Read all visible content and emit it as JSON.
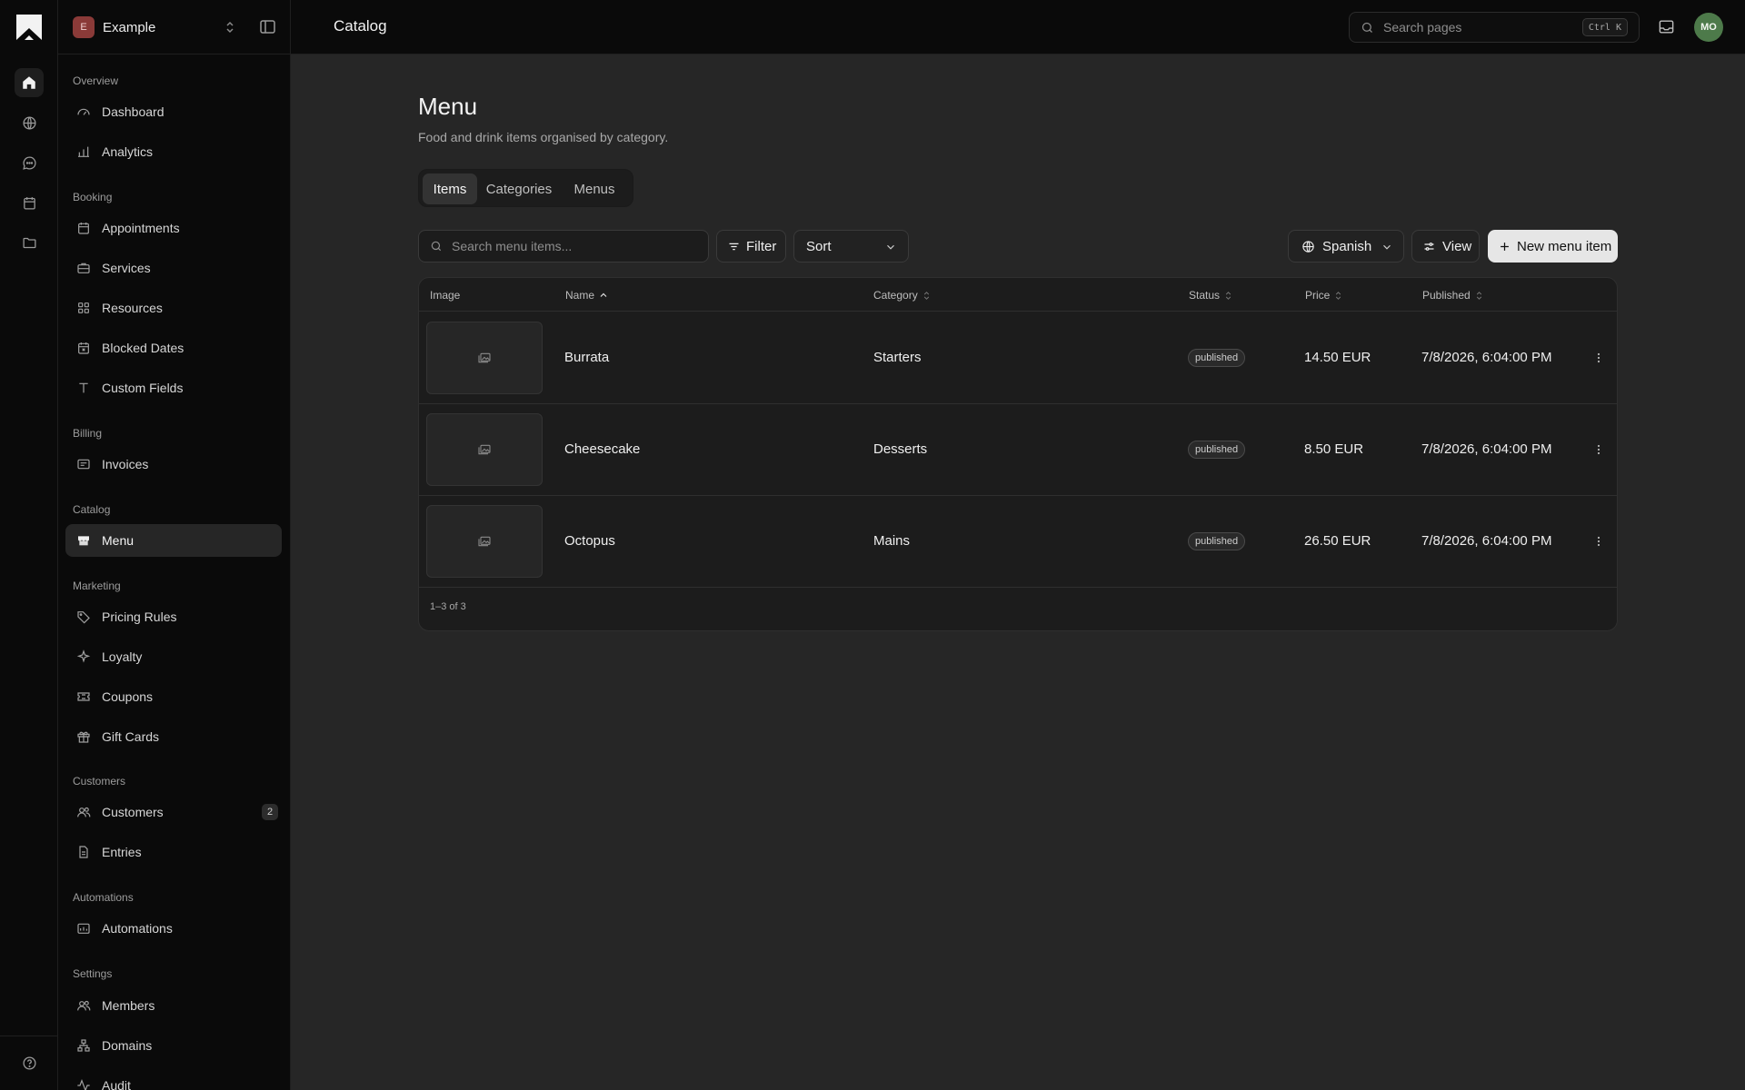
{
  "workspace": {
    "initial": "E",
    "name": "Example"
  },
  "header": {
    "title": "Catalog",
    "search_placeholder": "Search pages",
    "shortcut": "Ctrl K",
    "avatar_initials": "MO"
  },
  "sidebar": {
    "groups": {
      "overview": "Overview",
      "booking": "Booking",
      "billing": "Billing",
      "catalog": "Catalog",
      "marketing": "Marketing",
      "customers": "Customers",
      "automations": "Automations",
      "settings": "Settings"
    },
    "items": {
      "dashboard": "Dashboard",
      "analytics": "Analytics",
      "appointments": "Appointments",
      "services": "Services",
      "resources": "Resources",
      "blocked_dates": "Blocked Dates",
      "custom_fields": "Custom Fields",
      "invoices": "Invoices",
      "menu": "Menu",
      "pricing_rules": "Pricing Rules",
      "loyalty": "Loyalty",
      "coupons": "Coupons",
      "gift_cards": "Gift Cards",
      "customers": "Customers",
      "customers_count": "2",
      "entries": "Entries",
      "automations": "Automations",
      "members": "Members",
      "domains": "Domains",
      "audit": "Audit"
    },
    "active_item": "Menu"
  },
  "page": {
    "title": "Menu",
    "subtitle": "Food and drink items organised by category.",
    "tabs": [
      "Items",
      "Categories",
      "Menus"
    ],
    "active_tab": "Items"
  },
  "toolbar": {
    "search_placeholder": "Search menu items...",
    "filter_label": "Filter",
    "sort_label": "Sort",
    "language_label": "Spanish",
    "view_label": "View",
    "new_label": "New menu item"
  },
  "table": {
    "columns": [
      "Image",
      "Name",
      "Category",
      "Status",
      "Price",
      "Published"
    ],
    "sorted_column": "Name",
    "sort_direction": "ascending",
    "rows": [
      {
        "name": "Burrata",
        "category": "Starters",
        "status": "published",
        "price": "14.50 EUR",
        "published": "7/8/2026, 6:04:00 PM"
      },
      {
        "name": "Cheesecake",
        "category": "Desserts",
        "status": "published",
        "price": "8.50 EUR",
        "published": "7/8/2026, 6:04:00 PM"
      },
      {
        "name": "Octopus",
        "category": "Mains",
        "status": "published",
        "price": "26.50 EUR",
        "published": "7/8/2026, 6:04:00 PM"
      }
    ],
    "footer": "1–3 of 3"
  }
}
